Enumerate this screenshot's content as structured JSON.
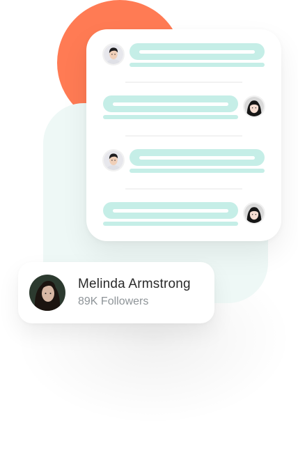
{
  "colors": {
    "accent_orange": "#FF7B54",
    "bubble_mint": "#C5EEE7",
    "panel_mint": "#EEF8F6",
    "card_white": "#FFFFFF",
    "name_text": "#2A2A2A",
    "followers_text": "#8E9498"
  },
  "chat": {
    "messages": [
      {
        "side": "left",
        "avatar": "man-avatar-icon"
      },
      {
        "side": "right",
        "avatar": "woman-avatar-icon"
      },
      {
        "side": "left",
        "avatar": "man-avatar-icon"
      },
      {
        "side": "right",
        "avatar": "woman-avatar-icon"
      }
    ]
  },
  "profile": {
    "name": "Melinda Armstrong",
    "followers": "89K Followers",
    "avatar": "profile-photo-avatar"
  }
}
